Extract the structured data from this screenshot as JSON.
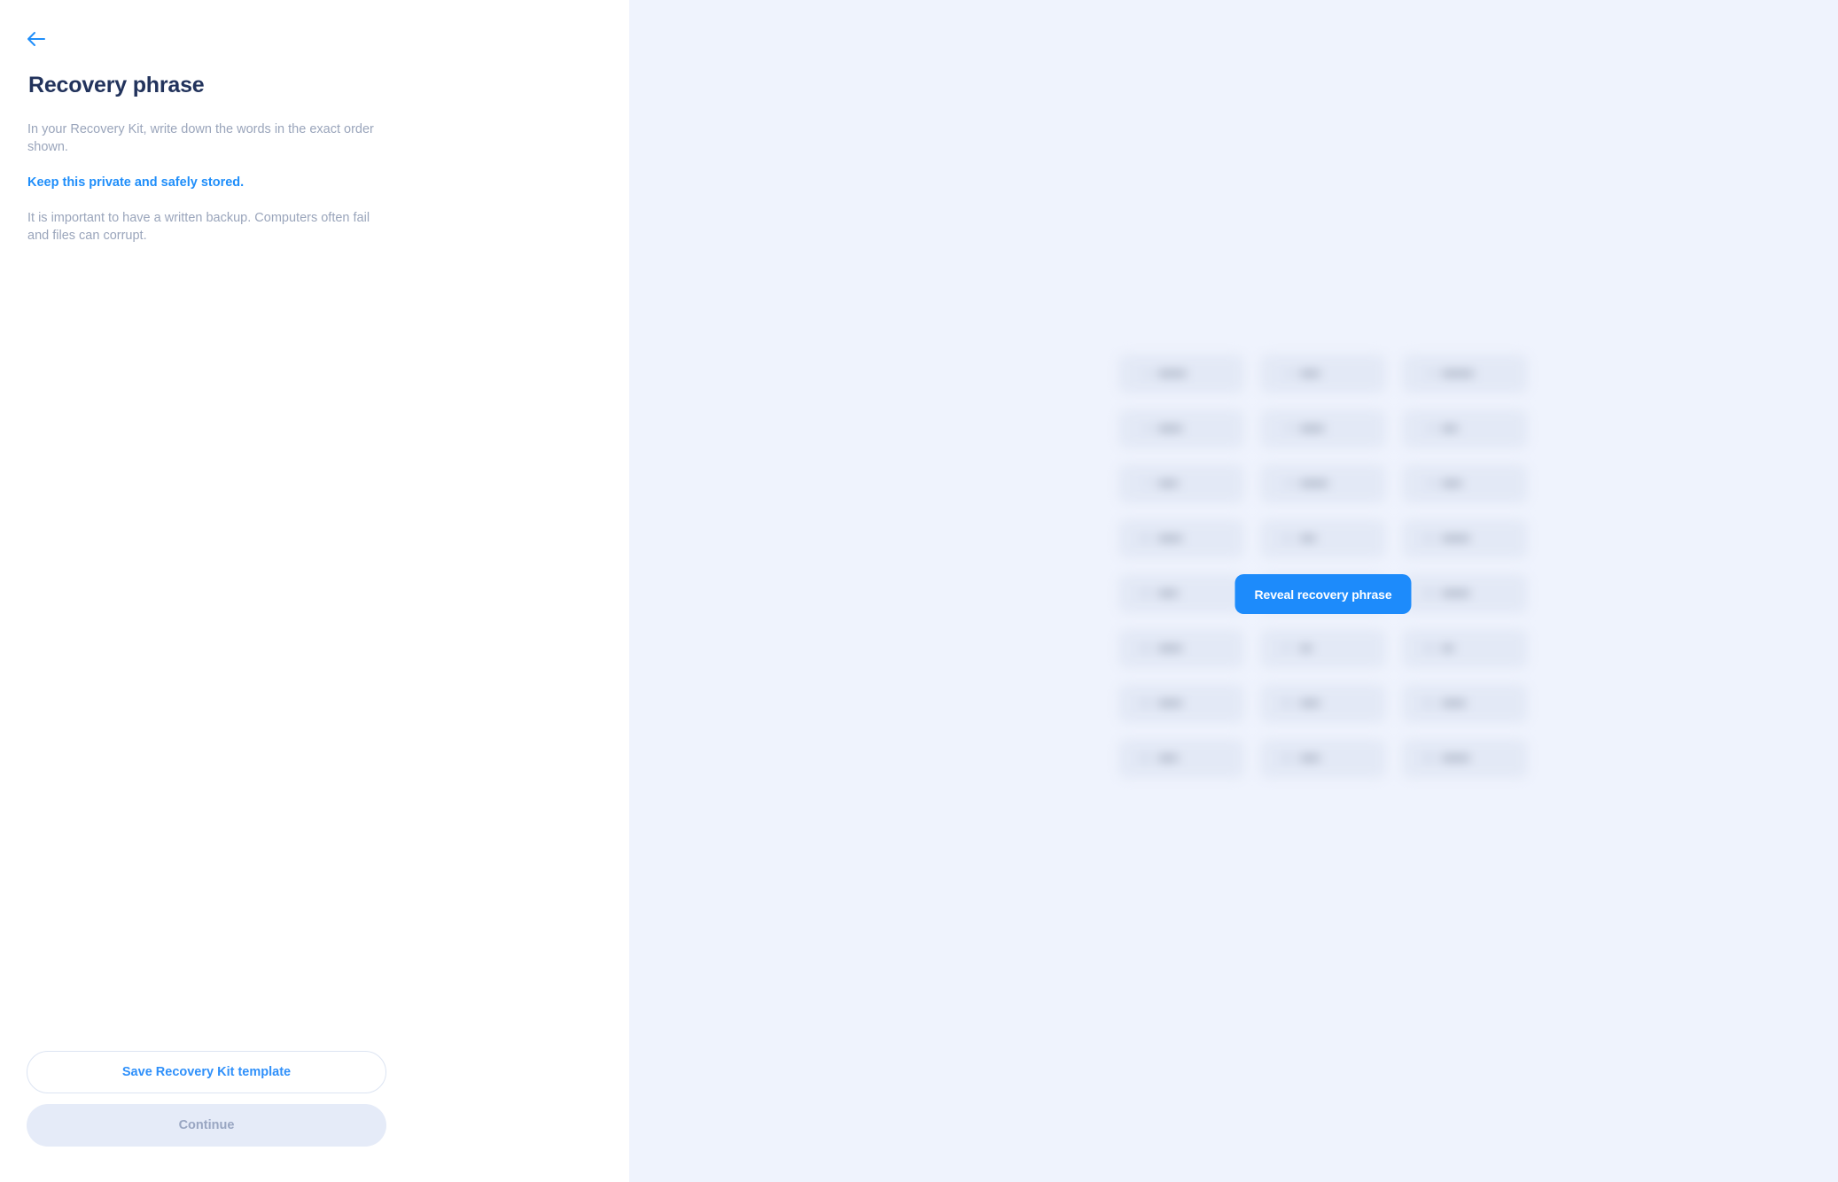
{
  "nav": {
    "back_icon": "arrow-left-icon",
    "back_label": "Back"
  },
  "left_panel": {
    "title": "Recovery phrase",
    "paragraphs": [
      "In your Recovery Kit, write down the words in the exact order shown.",
      "Keep this private and safely stored.",
      "It is important to have a written backup. Computers often fail and files can corrupt."
    ],
    "buttons": {
      "save_template": "Save Recovery Kit template",
      "continue": "Continue"
    }
  },
  "right_panel": {
    "reveal_button": "Reveal recovery phrase",
    "phrase_hidden": true,
    "words": [
      {
        "index": "1",
        "word": "•••••••"
      },
      {
        "index": "2",
        "word": "•••••"
      },
      {
        "index": "3",
        "word": "••••••••"
      },
      {
        "index": "4",
        "word": "••••••"
      },
      {
        "index": "5",
        "word": "••••••"
      },
      {
        "index": "6",
        "word": "••••"
      },
      {
        "index": "7",
        "word": "•••••"
      },
      {
        "index": "8",
        "word": "•••••••"
      },
      {
        "index": "9",
        "word": "•••••"
      },
      {
        "index": "10",
        "word": "••••••"
      },
      {
        "index": "11",
        "word": "••••"
      },
      {
        "index": "12",
        "word": "•••••••"
      },
      {
        "index": "13",
        "word": "•••••"
      },
      {
        "index": "14",
        "word": "••••••"
      },
      {
        "index": "15",
        "word": "•••••••"
      },
      {
        "index": "16",
        "word": "••••••"
      },
      {
        "index": "17",
        "word": "•••"
      },
      {
        "index": "18",
        "word": "•••"
      },
      {
        "index": "19",
        "word": "••••••"
      },
      {
        "index": "20",
        "word": "•••••"
      },
      {
        "index": "21",
        "word": "••••••"
      },
      {
        "index": "22",
        "word": "•••••"
      },
      {
        "index": "23",
        "word": "•••••"
      },
      {
        "index": "24",
        "word": "•••••••"
      }
    ]
  },
  "colors": {
    "accent_blue": "#1d8bfb",
    "link_blue": "#2f90fa",
    "title_navy": "#22335c",
    "body_grey": "#9aa5bb",
    "panel_bg": "#eff3fd",
    "chip_bg": "#e3e9f6",
    "disabled_bg": "#e5ebf8",
    "disabled_text": "#99a6c2"
  }
}
